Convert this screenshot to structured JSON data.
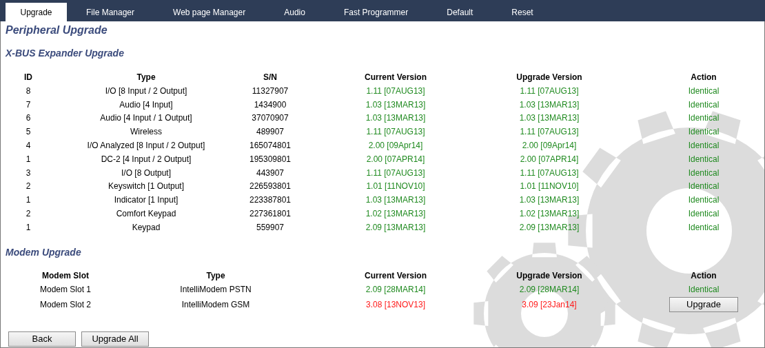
{
  "tabs": [
    {
      "label": "Upgrade",
      "selected": true
    },
    {
      "label": "File Manager",
      "selected": false
    },
    {
      "label": "Web page Manager",
      "selected": false
    },
    {
      "label": "Audio",
      "selected": false
    },
    {
      "label": "Fast Programmer",
      "selected": false
    },
    {
      "label": "Default",
      "selected": false
    },
    {
      "label": "Reset",
      "selected": false
    }
  ],
  "page_title": "Peripheral Upgrade",
  "xbus": {
    "title": "X-BUS Expander Upgrade",
    "columns": [
      "ID",
      "Type",
      "S/N",
      "Current Version",
      "Upgrade Version",
      "Action"
    ],
    "rows": [
      {
        "id": "8",
        "type": "I/O [8 Input / 2 Output]",
        "sn": "11327907",
        "current": "1.11 [07AUG13]",
        "upgrade": "1.11 [07AUG13]",
        "match": true,
        "action": {
          "kind": "text",
          "label": "Identical"
        }
      },
      {
        "id": "7",
        "type": "Audio [4 Input]",
        "sn": "1434900",
        "current": "1.03 [13MAR13]",
        "upgrade": "1.03 [13MAR13]",
        "match": true,
        "action": {
          "kind": "text",
          "label": "Identical"
        }
      },
      {
        "id": "6",
        "type": "Audio [4 Input / 1 Output]",
        "sn": "37070907",
        "current": "1.03 [13MAR13]",
        "upgrade": "1.03 [13MAR13]",
        "match": true,
        "action": {
          "kind": "text",
          "label": "Identical"
        }
      },
      {
        "id": "5",
        "type": "Wireless",
        "sn": "489907",
        "current": "1.11 [07AUG13]",
        "upgrade": "1.11 [07AUG13]",
        "match": true,
        "action": {
          "kind": "text",
          "label": "Identical"
        }
      },
      {
        "id": "4",
        "type": "I/O Analyzed [8 Input / 2 Output]",
        "sn": "165074801",
        "current": "2.00 [09Apr14]",
        "upgrade": "2.00 [09Apr14]",
        "match": true,
        "action": {
          "kind": "text",
          "label": "Identical"
        }
      },
      {
        "id": "1",
        "type": "DC-2 [4 Input / 2 Output]",
        "sn": "195309801",
        "current": "2.00 [07APR14]",
        "upgrade": "2.00 [07APR14]",
        "match": true,
        "action": {
          "kind": "text",
          "label": "Identical"
        }
      },
      {
        "id": "3",
        "type": "I/O [8 Output]",
        "sn": "443907",
        "current": "1.11 [07AUG13]",
        "upgrade": "1.11 [07AUG13]",
        "match": true,
        "action": {
          "kind": "text",
          "label": "Identical"
        }
      },
      {
        "id": "2",
        "type": "Keyswitch [1 Output]",
        "sn": "226593801",
        "current": "1.01 [11NOV10]",
        "upgrade": "1.01 [11NOV10]",
        "match": true,
        "action": {
          "kind": "text",
          "label": "Identical"
        }
      },
      {
        "id": "1",
        "type": "Indicator [1 Input]",
        "sn": "223387801",
        "current": "1.03 [13MAR13]",
        "upgrade": "1.03 [13MAR13]",
        "match": true,
        "action": {
          "kind": "text",
          "label": "Identical"
        }
      },
      {
        "id": "2",
        "type": "Comfort Keypad",
        "sn": "227361801",
        "current": "1.02 [13MAR13]",
        "upgrade": "1.02 [13MAR13]",
        "match": true,
        "action": {
          "kind": "text",
          "label": "Identical"
        }
      },
      {
        "id": "1",
        "type": "Keypad",
        "sn": "559907",
        "current": "2.09 [13MAR13]",
        "upgrade": "2.09 [13MAR13]",
        "match": true,
        "action": {
          "kind": "text",
          "label": "Identical"
        }
      }
    ]
  },
  "modem": {
    "title": "Modem Upgrade",
    "columns": [
      "Modem Slot",
      "Type",
      "Current Version",
      "Upgrade Version",
      "Action"
    ],
    "rows": [
      {
        "slot": "Modem Slot 1",
        "type": "IntelliModem PSTN",
        "current": "2.09 [28MAR14]",
        "upgrade": "2.09 [28MAR14]",
        "match": true,
        "action": {
          "kind": "text",
          "label": "Identical"
        }
      },
      {
        "slot": "Modem Slot 2",
        "type": "IntelliModem GSM",
        "current": "3.08 [13NOV13]",
        "upgrade": "3.09 [23Jan14]",
        "match": false,
        "action": {
          "kind": "button",
          "label": "Upgrade"
        }
      }
    ]
  },
  "buttons": [
    "Back",
    "Upgrade All"
  ]
}
